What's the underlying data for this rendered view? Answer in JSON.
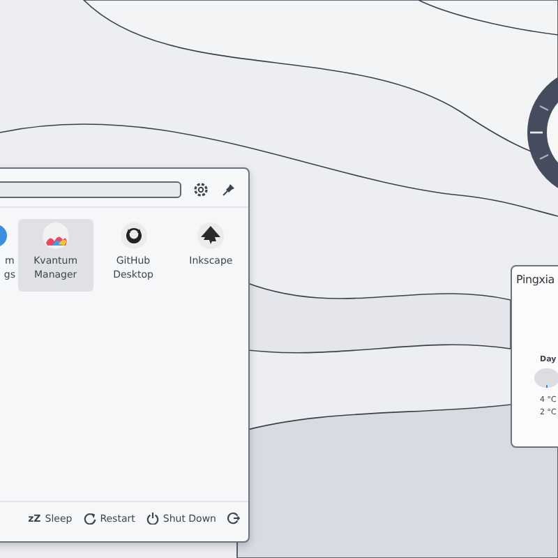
{
  "launcher": {
    "apps": [
      {
        "label_lines": [
          "m",
          "gs"
        ],
        "selected": false,
        "kind": "settings"
      },
      {
        "label_lines": [
          "Kvantum",
          "Manager"
        ],
        "selected": true,
        "kind": "kvantum"
      },
      {
        "label_lines": [
          "GitHub",
          "Desktop"
        ],
        "selected": false,
        "kind": "github"
      },
      {
        "label_lines": [
          "Inkscape"
        ],
        "selected": false,
        "kind": "inkscape"
      }
    ],
    "power": [
      {
        "kind": "sleep",
        "label": "Sleep",
        "glyph": "zZ"
      },
      {
        "kind": "restart",
        "label": "Restart"
      },
      {
        "kind": "shutdown",
        "label": "Shut Down"
      },
      {
        "kind": "logout"
      }
    ]
  },
  "weather": {
    "title": "Pingxia",
    "period": "Day",
    "high": "4 °C",
    "low": "2 °C"
  }
}
